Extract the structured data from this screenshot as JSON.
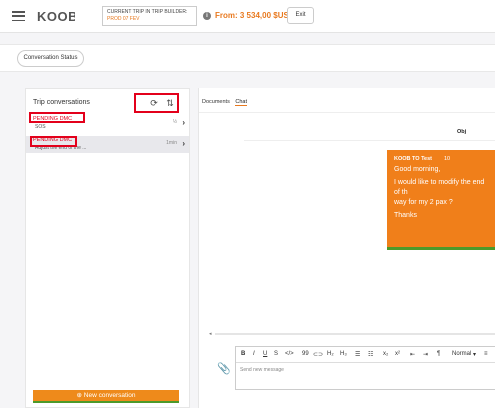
{
  "header": {
    "logo_text": "KOOB",
    "trip_label": "CURRENT TRIP IN TRIP BUILDER:",
    "trip_name": "PROD 07 FEV",
    "price": "From: 3 534,00 $US",
    "exit_label": "Exit"
  },
  "status_tab": {
    "label": "Conversation Status"
  },
  "left": {
    "title": "Trip conversations",
    "refresh_icon": "refresh-icon",
    "sort_icon": "sort-icon",
    "items": [
      {
        "status": "PENDING DMC",
        "subtitle": "SOS",
        "time": "½",
        "chevron": "›"
      },
      {
        "status": "PENDING DMC",
        "subtitle": "Adjust the end of the ...",
        "time": "1min",
        "chevron": "›"
      }
    ],
    "new_conversation": "⊕ New conversation"
  },
  "right": {
    "tabs": [
      "Documents",
      "Chat"
    ],
    "chat_header": "Obj",
    "message": {
      "sender": "KOOB TO Test",
      "badge": "10",
      "line1": "Good morning,",
      "line2": "I would like to modify the end of th",
      "line3": "way for my 2 pax ?",
      "line4": "Thanks"
    },
    "scroll_arrow": "◂",
    "attach_icon": "📎",
    "toolbar": {
      "bold": "B",
      "italic": "I",
      "underline": "U",
      "strike": "S",
      "code": "</>",
      "quote": "99",
      "link": "⊂⊃",
      "h2": "H₂",
      "h3": "H₃",
      "ul": "☰",
      "ol": "☷",
      "sub": "x₂",
      "sup": "x²",
      "indent_left": "⇤",
      "indent_right": "⇥",
      "paragraph": "¶",
      "style": "Normal",
      "style_caret": "▾",
      "align": "≡"
    },
    "placeholder": "Send new message"
  }
}
